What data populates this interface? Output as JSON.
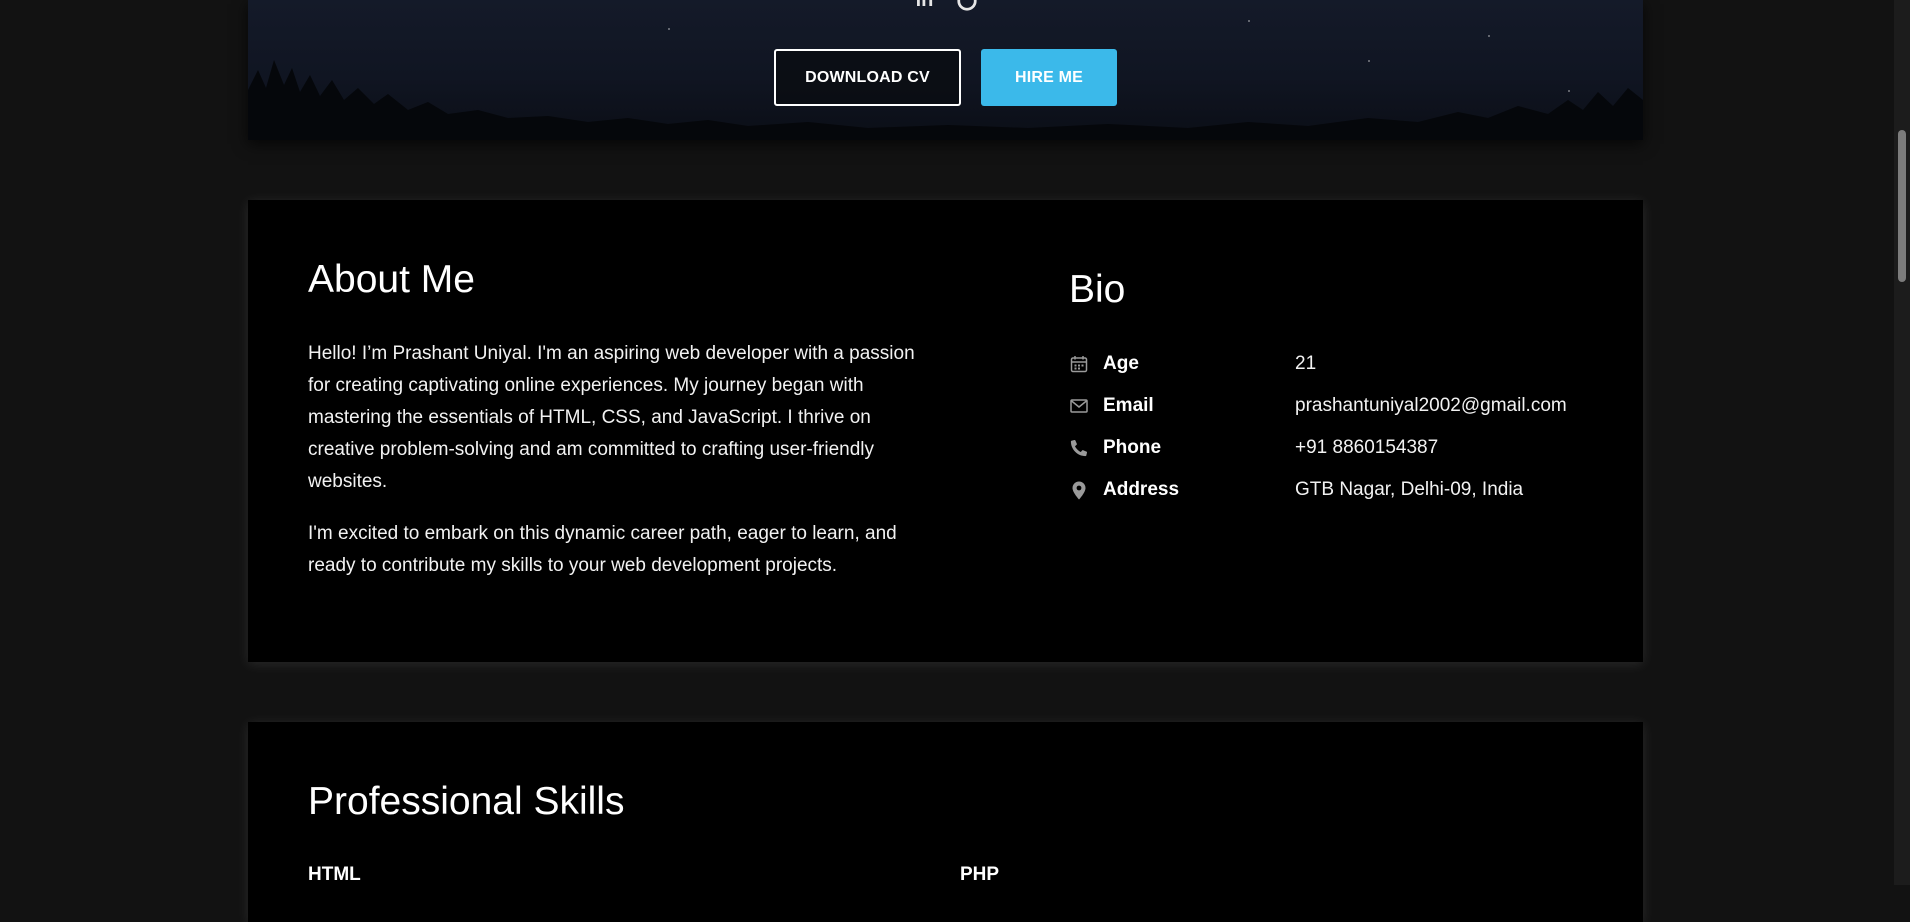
{
  "hero": {
    "social_icons": [
      "linkedin-icon",
      "github-icon"
    ],
    "download_cv_label": "DOWNLOAD CV",
    "hire_me_label": "HIRE ME",
    "accent_color": "#3bb9ea"
  },
  "about": {
    "title": "About Me",
    "paragraph_1": "Hello! I’m Prashant Uniyal. I'm an aspiring web developer with a passion for creating captivating online experiences. My journey began with mastering the essentials of HTML, CSS, and JavaScript. I thrive on creative problem-solving and am committed to crafting user-friendly websites.",
    "paragraph_2": "I'm excited to embark on this dynamic career path, eager to learn, and ready to contribute my skills to your web development projects."
  },
  "bio": {
    "title": "Bio",
    "rows": [
      {
        "icon": "calendar-icon",
        "key": "Age",
        "value": "21"
      },
      {
        "icon": "envelope-icon",
        "key": "Email",
        "value": "prashantuniyal2002@gmail.com"
      },
      {
        "icon": "phone-icon",
        "key": "Phone",
        "value": "+91 8860154387"
      },
      {
        "icon": "map-pin-icon",
        "key": "Address",
        "value": "GTB Nagar, Delhi-09, India"
      }
    ]
  },
  "skills": {
    "title": "Professional Skills",
    "items": [
      "HTML",
      "PHP"
    ]
  }
}
